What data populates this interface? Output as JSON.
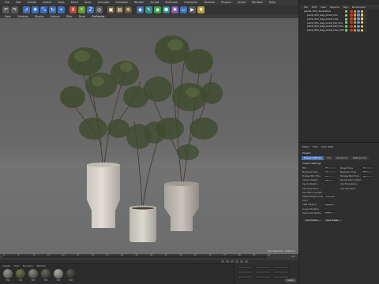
{
  "menubar": {
    "items": [
      "File",
      "Edit",
      "Create",
      "Select",
      "Tools",
      "Mesh",
      "Snap",
      "Animate",
      "Simulate",
      "Render",
      "Sculpt",
      "MoGraph",
      "Character",
      "Pipeline",
      "Plugins",
      "Script",
      "Window",
      "Help"
    ]
  },
  "toolbar": {
    "buttons": [
      {
        "icon": "undo-icon",
        "color": "#5a5a5a",
        "glyph": "↶"
      },
      {
        "icon": "redo-icon",
        "color": "#5a5a5a",
        "glyph": "↷"
      },
      {
        "icon": "live-selection-icon",
        "color": "#3d6fb8",
        "glyph": "➚"
      },
      {
        "icon": "move-icon",
        "color": "#3d6fb8",
        "glyph": "✥"
      },
      {
        "icon": "scale-icon",
        "color": "#3d6fb8",
        "glyph": "⤡"
      },
      {
        "icon": "rotate-icon",
        "color": "#3d6fb8",
        "glyph": "↻"
      },
      {
        "icon": "last-tool-icon",
        "color": "#3d6fb8",
        "glyph": "⌖"
      },
      {
        "icon": "x-axis-icon",
        "color": "#b84a3a",
        "glyph": "X"
      },
      {
        "icon": "y-axis-icon",
        "color": "#5f9a3a",
        "glyph": "Y"
      },
      {
        "icon": "z-axis-icon",
        "color": "#3d6fb8",
        "glyph": "Z"
      },
      {
        "icon": "world-coordinates-icon",
        "color": "#5a5a5a",
        "glyph": "◎"
      },
      {
        "icon": "render-view-icon",
        "color": "#6b5a3a",
        "glyph": "▣"
      },
      {
        "icon": "render-picture-viewer-icon",
        "color": "#6b5a3a",
        "glyph": "▤"
      },
      {
        "icon": "render-settings-icon",
        "color": "#6b5a3a",
        "glyph": "⚙"
      },
      {
        "icon": "cube-icon",
        "color": "#3d6fb8",
        "glyph": "◆"
      },
      {
        "icon": "pen-icon",
        "color": "#2f8f8f",
        "glyph": "✎"
      },
      {
        "icon": "subdivision-icon",
        "color": "#3f9a4a",
        "glyph": "◉"
      },
      {
        "icon": "array-icon",
        "color": "#2f8f8f",
        "glyph": "⬢"
      },
      {
        "icon": "deformer-icon",
        "color": "#8a5ab8",
        "glyph": "✱"
      },
      {
        "icon": "floor-icon",
        "color": "#3d6fb8",
        "glyph": "▭"
      },
      {
        "icon": "camera-icon",
        "color": "#5a5a5a",
        "glyph": "▶"
      },
      {
        "icon": "light-icon",
        "color": "#b8a03a",
        "glyph": "✹"
      }
    ]
  },
  "viewport": {
    "menu": [
      "View",
      "Cameras",
      "Display",
      "Options",
      "Filter",
      "Panel"
    ],
    "mode": "ProRender",
    "status": "Grid Spacing : 1000 cm"
  },
  "timeline": {
    "ticks": [
      "0",
      "5",
      "10",
      "15",
      "20",
      "25",
      "30",
      "35",
      "40",
      "45",
      "50",
      "55",
      "60",
      "65",
      "70",
      "75",
      "80",
      "85",
      "90"
    ],
    "readout": "0 F"
  },
  "material_manager": {
    "menu": [
      "Create",
      "Edit",
      "Function",
      "Texture"
    ],
    "materials": [
      {
        "label": "Mat",
        "color_a": "#9a9a94",
        "color_b": "#3a3a38"
      },
      {
        "label": "Mat",
        "color_a": "#6f7a4a",
        "color_b": "#2a3020"
      },
      {
        "label": "Mat",
        "color_a": "#8a8a80",
        "color_b": "#333330"
      },
      {
        "label": "Mat",
        "color_a": "#6a6a62",
        "color_b": "#262622"
      },
      {
        "label": "Mat",
        "color_a": "#b0b0a8",
        "color_b": "#4a4a46"
      },
      {
        "label": "Mat",
        "color_a": "#5a5a54",
        "color_b": "#1e1e1c"
      }
    ]
  },
  "coordinates": {
    "apply": "Apply"
  },
  "object_manager": {
    "menu": [
      "File",
      "Edit",
      "View",
      "Objects",
      "Tags",
      "Bookmarks"
    ],
    "active_menu": "Tags",
    "rows": [
      {
        "name": "plants_001_decorative",
        "indent": 0
      },
      {
        "name": "plant_001_bag_small_min",
        "indent": 1
      },
      {
        "name": "plant_001_bag_small_max",
        "indent": 1
      },
      {
        "name": "plant_001_bag_small_tall_min",
        "indent": 1
      },
      {
        "name": "plant_001_bag_small_tall_max",
        "indent": 1
      },
      {
        "name": "plant_001_bag_small_max_001",
        "indent": 1
      }
    ],
    "tag_colors": [
      "#c04030",
      "#e0a040",
      "#6a9ad0",
      "#f0d070",
      "#3a3a3a"
    ]
  },
  "attribute_manager": {
    "menu": [
      "Mode",
      "Edit",
      "User Data"
    ],
    "title": "Project",
    "tabs": [
      "Project Settings",
      "Info",
      "Dynamics",
      "Referencing"
    ],
    "tabs_row2": [
      "To Do",
      "Key Interpolation"
    ],
    "section": "Project Settings",
    "rows_left": [
      {
        "label": "FPS",
        "value": "30"
      },
      {
        "label": "Minimum Time",
        "value": "0 F"
      },
      {
        "label": "Preview Min Time",
        "value": "0 F"
      },
      {
        "label": "Level of Detail",
        "value": "100 %"
      },
      {
        "label": "Use Animation",
        "value": ""
      },
      {
        "label": "Use Generators",
        "value": ""
      },
      {
        "label": "Use Motion System",
        "value": ""
      },
      {
        "label": "Default Object Color",
        "value": "Gray-Blue"
      },
      {
        "label": "Color",
        "value": ""
      },
      {
        "label": "View Clipping",
        "value": "Medium"
      },
      {
        "label": "Linear Workflow",
        "value": ""
      },
      {
        "label": "Input Color Profile",
        "value": "sRGB"
      }
    ],
    "rows_right": [
      {
        "label": "Project Time",
        "value": "0 F"
      },
      {
        "label": "Maximum Time",
        "value": "90 F"
      },
      {
        "label": "Preview Max Time",
        "value": "90 F"
      },
      {
        "label": "Render LOD in Editor",
        "value": ""
      },
      {
        "label": "Use Expressions",
        "value": ""
      },
      {
        "label": "Use Deformers",
        "value": ""
      }
    ],
    "buttons": [
      "Load Preset...",
      "Save Preset..."
    ]
  }
}
